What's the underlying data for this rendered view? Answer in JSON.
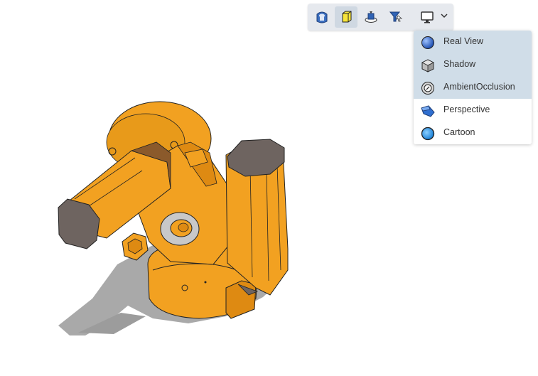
{
  "toolbar": {
    "buttons": [
      {
        "icon": "render-mode-icon",
        "active": false
      },
      {
        "icon": "solid-box-icon",
        "active": true
      },
      {
        "icon": "section-view-icon",
        "active": false
      },
      {
        "icon": "filter-icon",
        "active": false
      },
      {
        "icon": "display-monitor-icon",
        "active": false
      }
    ],
    "dropdown_icon": "chevron-down-icon"
  },
  "display_menu": {
    "items": [
      {
        "label": "Real View",
        "icon": "sphere-icon",
        "selected": true
      },
      {
        "label": "Shadow",
        "icon": "cube-icon",
        "selected": true
      },
      {
        "label": "AmbientOcclusion",
        "icon": "occlusion-icon",
        "selected": true
      },
      {
        "label": "Perspective",
        "icon": "perspective-icon",
        "selected": false
      },
      {
        "label": "Cartoon",
        "icon": "cartoon-sphere-icon",
        "selected": false
      }
    ]
  },
  "colors": {
    "model_primary": "#F2A121",
    "model_secondary": "#DE8A12",
    "motor_cap": "#6E6460",
    "shadow": "#A6A6A6",
    "menu_selected": "#D0DDE8",
    "toolbar_bg": "#E6E9EE"
  }
}
